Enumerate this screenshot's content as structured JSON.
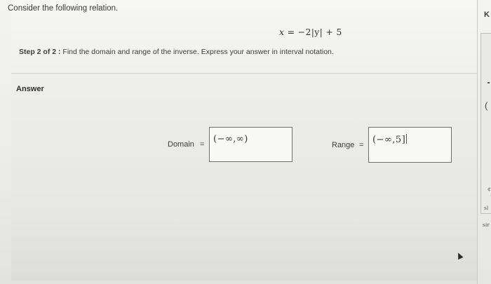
{
  "problem": {
    "prompt": "Consider the following relation.",
    "equation": {
      "lhs_var": "x",
      "rhs": " = −2|y| + 5"
    }
  },
  "step": {
    "label": "Step 2 of 2 :",
    "instruction": " Find the domain and range of the inverse. Express your answer in interval notation."
  },
  "answer": {
    "heading": "Answer",
    "domain": {
      "label": "Domain",
      "equals": "=",
      "value": "(−∞,∞)"
    },
    "range": {
      "label": "Range",
      "equals": "=",
      "value": "(−∞,5]"
    }
  },
  "side_panel": {
    "header": "K",
    "paren": "(",
    "line1": "¢",
    "line2": "sl",
    "line3": "sir"
  }
}
